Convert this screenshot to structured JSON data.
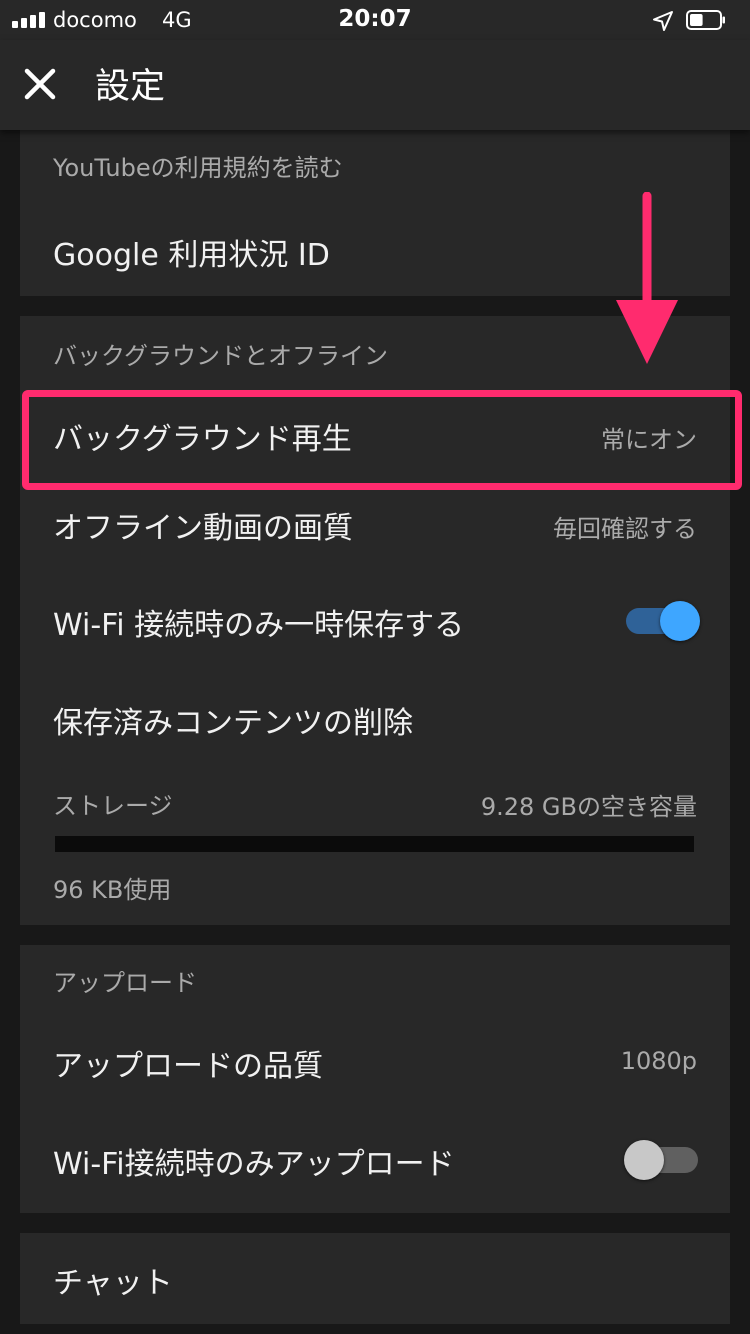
{
  "status_bar": {
    "carrier": "docomo",
    "network": "4G",
    "time": "20:07",
    "signal_bars": 4,
    "battery_level": 0.45
  },
  "app_bar": {
    "title": "設定",
    "close_icon": "close-icon"
  },
  "sections": {
    "legal": {
      "terms_link": "YouTubeの利用規約を読む",
      "google_usage_id": "Google 利用状況 ID"
    },
    "background_offline": {
      "header": "バックグラウンドとオフライン",
      "background_play_label": "バックグラウンド再生",
      "background_play_value": "常にオン",
      "offline_quality_label": "オフライン動画の画質",
      "offline_quality_value": "毎回確認する",
      "wifi_only_save_label": "Wi-Fi 接続時のみ一時保存する",
      "wifi_only_save_on": true,
      "delete_saved_label": "保存済みコンテンツの削除",
      "storage_label": "ストレージ",
      "storage_free": "9.28 GBの空き容量",
      "storage_used": "96 KB使用",
      "storage_used_fraction": 0.0
    },
    "upload": {
      "header": "アップロード",
      "quality_label": "アップロードの品質",
      "quality_value": "1080p",
      "wifi_only_upload_label": "Wi-Fi接続時のみアップロード",
      "wifi_only_upload_on": false
    },
    "chat": {
      "label": "チャット"
    }
  },
  "colors": {
    "background": "#181818",
    "card": "#282828",
    "accent_blue": "#3ea6ff",
    "annotation_pink": "#ff2b6e"
  }
}
